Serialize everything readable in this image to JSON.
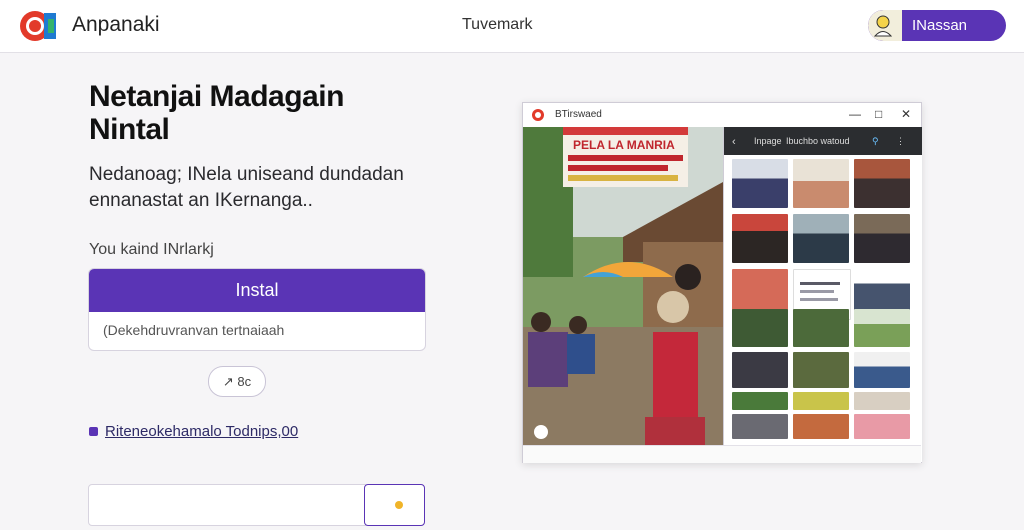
{
  "header": {
    "app_title": "Anpanaki",
    "center_link": "Tuvemark",
    "user_name": "INassan"
  },
  "hero": {
    "title": "Netanjai Madagain Nintal",
    "subtitle": "Nedanoag; INela uniseand dundadan ennanastat an IKernanga.."
  },
  "install_section": {
    "label": "You kaind INrlarkj",
    "install_button": "Instal",
    "input_value": "(Dekehdruvranvan tertnaiaah",
    "small_button": "↗ 8c"
  },
  "footnote": {
    "link_text": "Riteneokehamalo Todnips,00"
  },
  "preview": {
    "window_title": "BTirswaed",
    "gallery_title": "Inpage",
    "gallery_subtitle": "Ibuchbo watoud",
    "banner_text": "PELA LA MANRIA"
  },
  "colors": {
    "accent": "#5a34b5",
    "background": "#f6f5f7"
  }
}
